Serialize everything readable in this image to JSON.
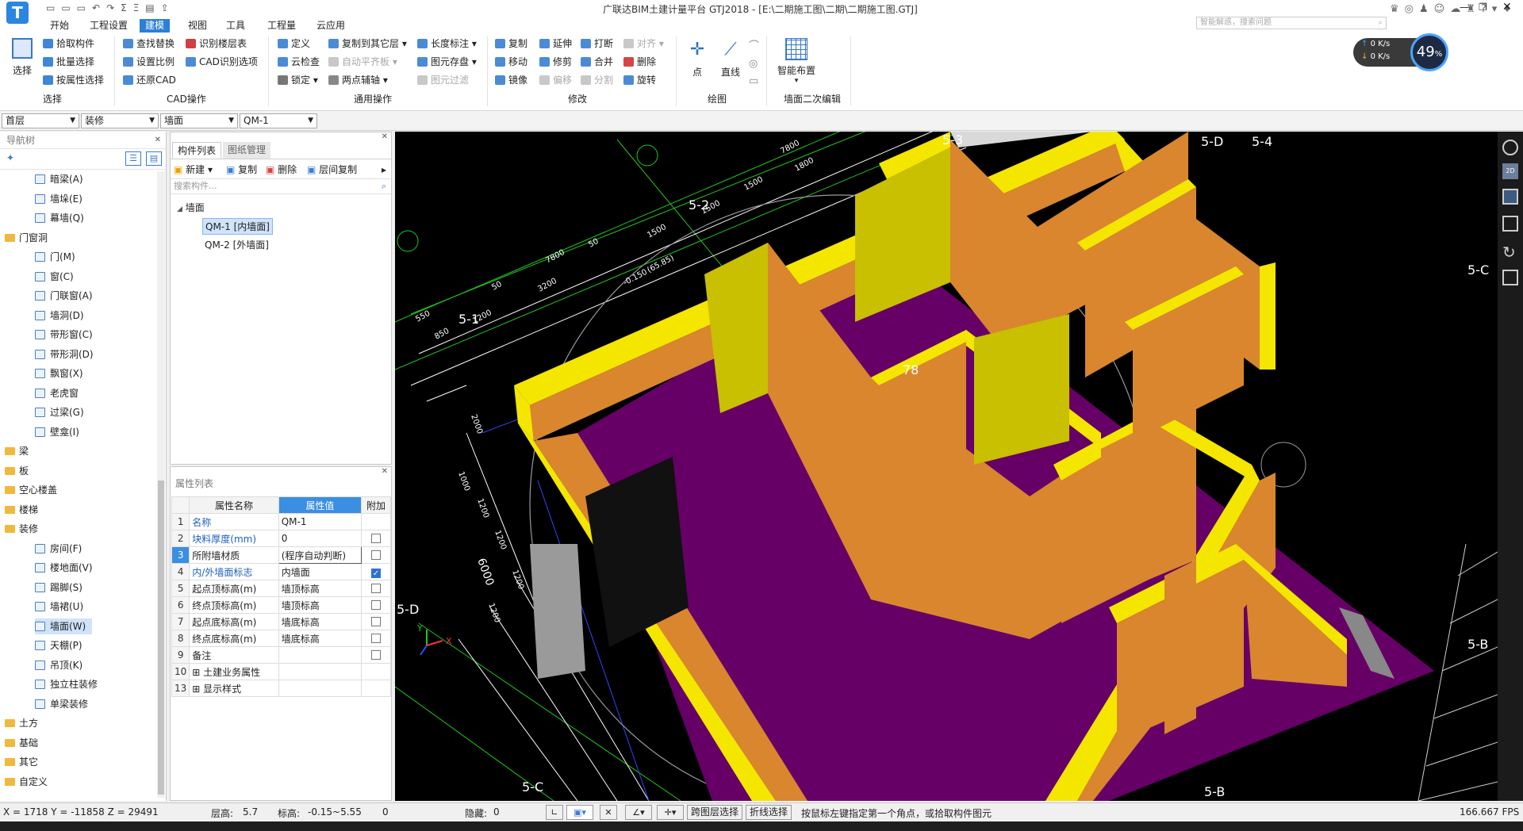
{
  "window": {
    "title": "广联达BIM土建计量平台 GTJ2018 - [E:\\二期施工图\\二期\\二期施工图.GTJ]",
    "search_placeholder": "智能解惑，搜索问题"
  },
  "menu": {
    "items": [
      "开始",
      "工程设置",
      "建模",
      "视图",
      "工具",
      "工程量",
      "云应用"
    ],
    "active_index": 2
  },
  "ribbon": {
    "select_group": {
      "big_label": "选择",
      "items": [
        "拾取构件",
        "批量选择",
        "按属性选择"
      ],
      "label": "选择"
    },
    "cad_group": {
      "items": [
        "查找替换",
        "识别楼层表",
        "设置比例",
        "CAD识别选项",
        "还原CAD"
      ],
      "label": "CAD操作"
    },
    "common_group": {
      "items": [
        "定义",
        "复制到其它层",
        "长度标注",
        "云检查",
        "自动平齐板",
        "图元存盘",
        "锁定",
        "两点辅轴",
        "图元过滤"
      ],
      "label": "通用操作"
    },
    "modify_group": {
      "items": [
        "复制",
        "延伸",
        "打断",
        "对齐",
        "移动",
        "修剪",
        "合并",
        "删除",
        "镜像",
        "偏移",
        "分割",
        "旋转"
      ],
      "label": "修改"
    },
    "draw_group": {
      "items": [
        "点",
        "直线"
      ],
      "label": "绘图"
    },
    "wall_group": {
      "big_label": "智能布置",
      "label": "墙面二次编辑"
    },
    "network": {
      "up": "0 K/s",
      "down": "0 K/s",
      "percent": "49",
      "percent_sign": "%"
    }
  },
  "selectors": [
    "首层",
    "装修",
    "墙面",
    "QM-1"
  ],
  "nav": {
    "title": "导航树",
    "items": [
      {
        "label": "暗梁(A)",
        "type": "item"
      },
      {
        "label": "墙垛(E)",
        "type": "item"
      },
      {
        "label": "幕墙(Q)",
        "type": "item"
      },
      {
        "label": "门窗洞",
        "type": "folder"
      },
      {
        "label": "门(M)",
        "type": "item"
      },
      {
        "label": "窗(C)",
        "type": "item"
      },
      {
        "label": "门联窗(A)",
        "type": "item"
      },
      {
        "label": "墙洞(D)",
        "type": "item"
      },
      {
        "label": "带形窗(C)",
        "type": "item"
      },
      {
        "label": "带形洞(D)",
        "type": "item"
      },
      {
        "label": "飘窗(X)",
        "type": "item"
      },
      {
        "label": "老虎窗",
        "type": "item"
      },
      {
        "label": "过梁(G)",
        "type": "item"
      },
      {
        "label": "壁龛(I)",
        "type": "item"
      },
      {
        "label": "梁",
        "type": "folder"
      },
      {
        "label": "板",
        "type": "folder"
      },
      {
        "label": "空心楼盖",
        "type": "folder"
      },
      {
        "label": "楼梯",
        "type": "folder"
      },
      {
        "label": "装修",
        "type": "folder"
      },
      {
        "label": "房间(F)",
        "type": "item"
      },
      {
        "label": "楼地面(V)",
        "type": "item"
      },
      {
        "label": "踢脚(S)",
        "type": "item"
      },
      {
        "label": "墙裙(U)",
        "type": "item"
      },
      {
        "label": "墙面(W)",
        "type": "item",
        "selected": true
      },
      {
        "label": "天棚(P)",
        "type": "item"
      },
      {
        "label": "吊顶(K)",
        "type": "item"
      },
      {
        "label": "独立柱装修",
        "type": "item"
      },
      {
        "label": "单梁装修",
        "type": "item"
      },
      {
        "label": "土方",
        "type": "folder"
      },
      {
        "label": "基础",
        "type": "folder"
      },
      {
        "label": "其它",
        "type": "folder"
      },
      {
        "label": "自定义",
        "type": "folder"
      }
    ]
  },
  "components": {
    "tabs": [
      "构件列表",
      "图纸管理"
    ],
    "toolbar": [
      "新建",
      "复制",
      "删除",
      "层间复制"
    ],
    "search_placeholder": "搜索构件...",
    "root": "墙面",
    "items": [
      "QM-1 [内墙面]",
      "QM-2 [外墙面]"
    ]
  },
  "properties": {
    "title": "属性列表",
    "headers": [
      "属性名称",
      "属性值",
      "附加"
    ],
    "rows": [
      {
        "idx": "1",
        "name": "名称",
        "value": "QM-1",
        "blue": true,
        "check": null
      },
      {
        "idx": "2",
        "name": "块料厚度(mm)",
        "value": "0",
        "blue": true,
        "check": false
      },
      {
        "idx": "3",
        "name": "所附墙材质",
        "value": "(程序自动判断)",
        "blue": false,
        "check": false
      },
      {
        "idx": "4",
        "name": "内/外墙面标志",
        "value": "内墙面",
        "blue": true,
        "check": true
      },
      {
        "idx": "5",
        "name": "起点顶标高(m)",
        "value": "墙顶标高",
        "blue": false,
        "check": false
      },
      {
        "idx": "6",
        "name": "终点顶标高(m)",
        "value": "墙顶标高",
        "blue": false,
        "check": false
      },
      {
        "idx": "7",
        "name": "起点底标高(m)",
        "value": "墙底标高",
        "blue": false,
        "check": false
      },
      {
        "idx": "8",
        "name": "终点底标高(m)",
        "value": "墙底标高",
        "blue": false,
        "check": false
      },
      {
        "idx": "9",
        "name": "备注",
        "value": "",
        "blue": false,
        "check": false
      },
      {
        "idx": "10",
        "name": "土建业务属性",
        "value": "",
        "blue": false,
        "check": null,
        "expand": true
      },
      {
        "idx": "13",
        "name": "显示样式",
        "value": "",
        "blue": false,
        "check": null,
        "expand": true
      }
    ]
  },
  "viewport": {
    "axis_labels": [
      "5-D",
      "5-4",
      "5-3",
      "5-2",
      "5-1",
      "5-C",
      "5-B",
      "5-C",
      "5-D",
      "5-B"
    ],
    "dims": [
      "7800",
      "1800",
      "1500",
      "1500",
      "1500",
      "7800",
      "3200",
      "1200",
      "850",
      "550",
      "50",
      "50",
      "-0.150",
      "(65.85)",
      "2000",
      "1000",
      "1200",
      "1200",
      "1200",
      "6000",
      "1200",
      "78"
    ],
    "colors": {
      "wall": "#d9862f",
      "wall_top": "#f5e600",
      "floor": "#6a0068",
      "grid": "#1ec81e",
      "dim": "#ffffff",
      "cad": "#3344ff"
    }
  },
  "status": {
    "coords": "X = 1718 Y = -11858 Z = 29491",
    "floor_height_label": "层高:",
    "floor_height": "5.7",
    "elev_label": "标高:",
    "elev": "-0.15~5.55",
    "zero": "0",
    "hidden_label": "隐藏:",
    "hidden": "0",
    "btn_cross_layer": "跨图层选择",
    "btn_polyline": "折线选择",
    "hint": "按鼠标左键指定第一个角点，或拾取构件图元",
    "fps": "166.667 FPS"
  }
}
